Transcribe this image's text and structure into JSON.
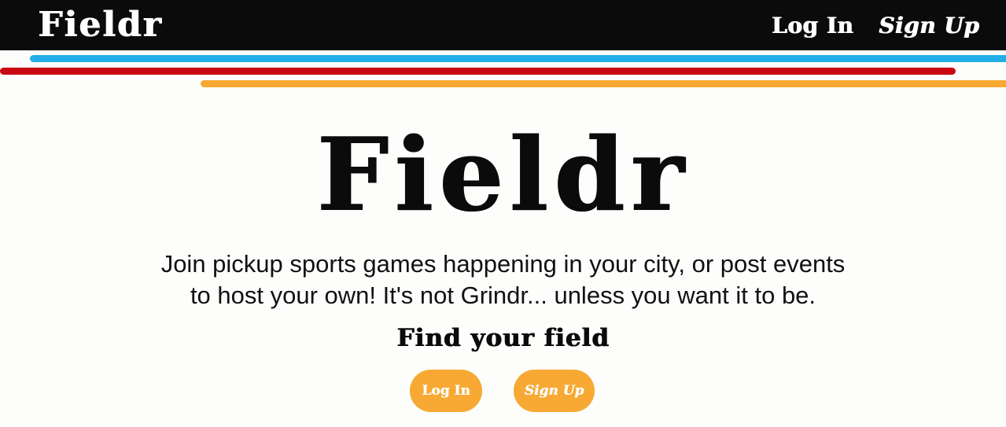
{
  "navbar": {
    "brand": "Fieldr",
    "links": [
      {
        "label": "Log In"
      },
      {
        "label": "Sign Up"
      }
    ]
  },
  "stripes": {
    "blue": "#23aee8",
    "red": "#c90a12",
    "orange": "#f7a933"
  },
  "hero": {
    "title": "Fieldr",
    "tagline_line1": "Join pickup sports games happening in your city, or post events",
    "tagline_line2": "to host your own! It's not Grindr... unless you want it to be.",
    "subhead": "Find your field",
    "login_button": "Log In",
    "signup_button": "Sign Up"
  },
  "colors": {
    "navbar_bg": "#0b0b0b",
    "page_bg": "#fdfdfb",
    "button_bg": "#f7a933",
    "text": "#0b0b0b"
  }
}
